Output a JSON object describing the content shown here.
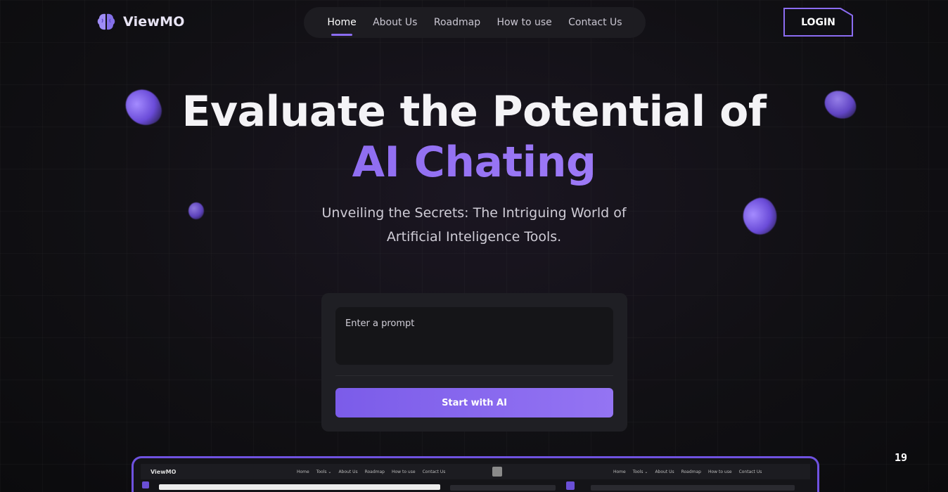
{
  "brand": {
    "name": "ViewMO",
    "accent": "#8b6cf1"
  },
  "nav": {
    "items": [
      {
        "label": "Home",
        "active": true
      },
      {
        "label": "About Us"
      },
      {
        "label": "Roadmap"
      },
      {
        "label": "How to use"
      },
      {
        "label": "Contact Us"
      }
    ]
  },
  "login": {
    "label": "LOGIN"
  },
  "hero": {
    "title_line1": "Evaluate the Potential of",
    "title_line2": "AI Chating",
    "subtitle_line1": "Unveiling the Secrets: The Intriguing World of",
    "subtitle_line2": "Artificial Inteligence Tools."
  },
  "prompt": {
    "placeholder": "Enter a prompt",
    "button_label": "Start with AI"
  },
  "preview": {
    "logo": "ViewMO",
    "nav_left": [
      "Home",
      "Tools ⌄",
      "About Us",
      "Roadmap",
      "How to use",
      "Contact Us"
    ],
    "nav_right": [
      "Home",
      "Tools ⌄",
      "About Us",
      "Roadmap",
      "How to use",
      "Contact Us"
    ]
  },
  "page_number": "19"
}
